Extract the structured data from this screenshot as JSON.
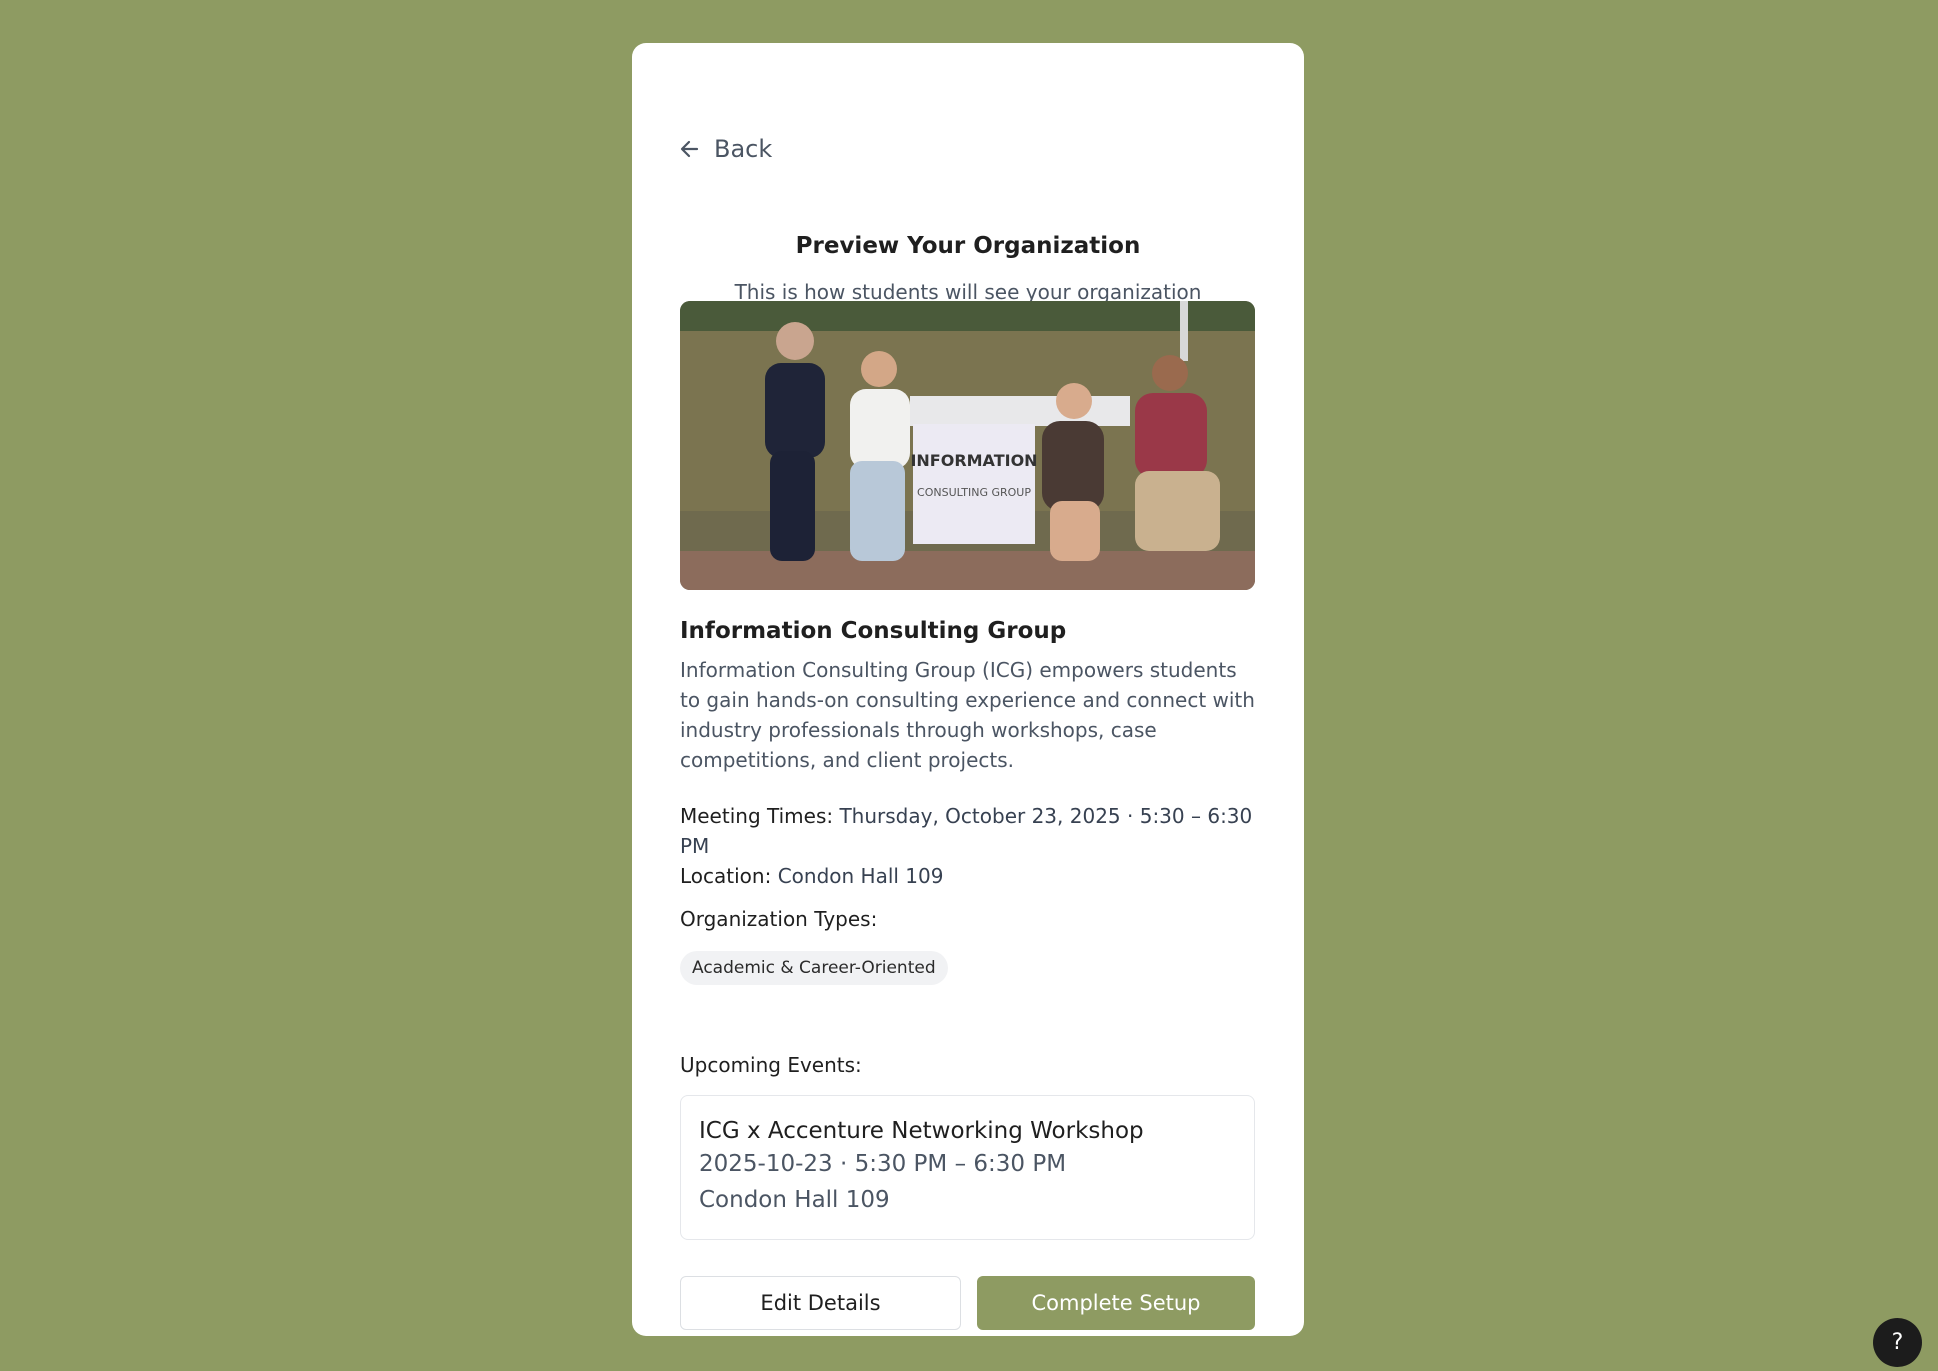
{
  "nav": {
    "back_label": "Back"
  },
  "header": {
    "title": "Preview Your Organization",
    "subtitle": "This is how students will see your organization"
  },
  "photo": {
    "sign_line1": "INFORMATION",
    "sign_line2": "CONSULTING GROUP"
  },
  "organization": {
    "name": "Information Consulting Group",
    "description": "Information Consulting Group (ICG) empowers students to gain hands-on consulting experience and connect with industry professionals through workshops, case competitions, and client projects.",
    "meeting_label": "Meeting Times:",
    "meeting_value": "Thursday, October 23, 2025 · 5:30 – 6:30 PM",
    "location_label": "Location:",
    "location_value": "Condon Hall 109",
    "types_label": "Organization Types:",
    "types": [
      "Academic & Career-Oriented"
    ]
  },
  "events": {
    "label": "Upcoming Events:",
    "items": [
      {
        "title": "ICG x Accenture Networking Workshop",
        "datetime": "2025-10-23 · 5:30 PM – 6:30 PM",
        "location": "Condon Hall 109"
      }
    ]
  },
  "actions": {
    "edit_label": "Edit Details",
    "complete_label": "Complete Setup"
  },
  "help": {
    "label": "?"
  },
  "colors": {
    "background": "#8e9b62",
    "primary": "#8e9b62",
    "card": "#ffffff"
  }
}
